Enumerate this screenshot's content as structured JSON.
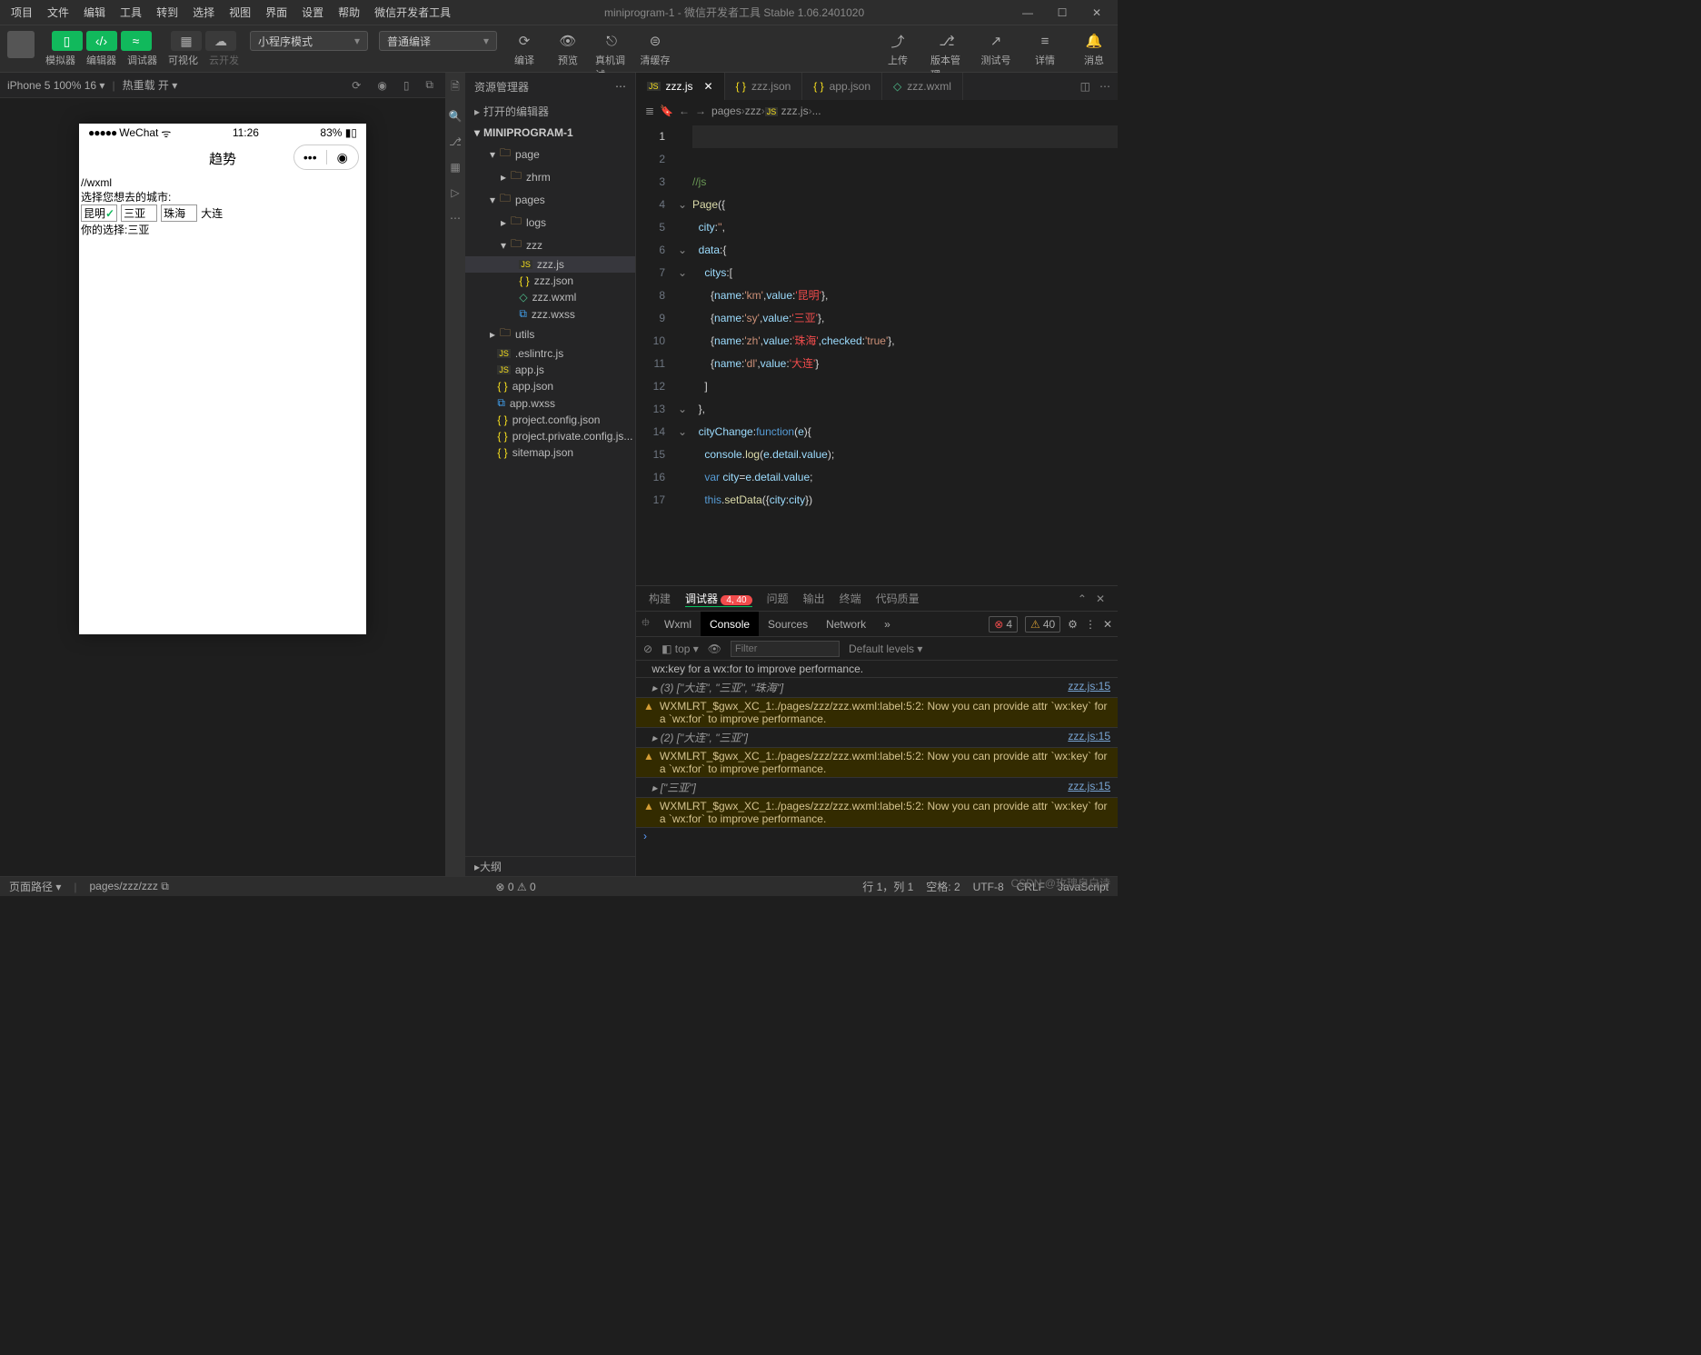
{
  "window": {
    "title": "miniprogram-1 - 微信开发者工具 Stable 1.06.2401020",
    "menus": [
      "项目",
      "文件",
      "编辑",
      "工具",
      "转到",
      "选择",
      "视图",
      "界面",
      "设置",
      "帮助",
      "微信开发者工具"
    ]
  },
  "toolbar": {
    "sim": "模拟器",
    "editor": "编辑器",
    "debugger": "调试器",
    "visual": "可视化",
    "cloud": "云开发",
    "mode": "小程序模式",
    "compile_mode": "普通编译",
    "compile": "编译",
    "preview": "预览",
    "remote": "真机调试",
    "clear": "清缓存",
    "upload": "上传",
    "version": "版本管理",
    "test": "测试号",
    "detail": "详情",
    "msg": "消息"
  },
  "simbar": {
    "device": "iPhone 5 100% 16",
    "hotreload": "热重载 开"
  },
  "phone": {
    "carrier": "WeChat",
    "time": "11:26",
    "battery": "83%",
    "title": "趋势",
    "body": {
      "l1": "//wxml",
      "l2": "选择您想去的城市:",
      "cities": [
        "昆明",
        "三亚",
        "珠海",
        "大连"
      ],
      "checked_index": 0,
      "selected": "你的选择:三亚"
    }
  },
  "explorer": {
    "title": "资源管理器",
    "s1": "打开的编辑器",
    "s2": "MINIPROGRAM-1",
    "outline": "大纲",
    "items": [
      {
        "ind": 1,
        "kind": "folder",
        "name": "page",
        "exp": true
      },
      {
        "ind": 2,
        "kind": "folder",
        "name": "zhrm",
        "exp": false
      },
      {
        "ind": 1,
        "kind": "folder",
        "name": "pages",
        "exp": true
      },
      {
        "ind": 2,
        "kind": "folder",
        "name": "logs",
        "exp": false
      },
      {
        "ind": 2,
        "kind": "folder",
        "name": "zzz",
        "exp": true
      },
      {
        "ind": 3,
        "kind": "js",
        "name": "zzz.js",
        "sel": true
      },
      {
        "ind": 3,
        "kind": "json",
        "name": "zzz.json"
      },
      {
        "ind": 3,
        "kind": "wxml",
        "name": "zzz.wxml"
      },
      {
        "ind": 3,
        "kind": "wxss",
        "name": "zzz.wxss"
      },
      {
        "ind": 1,
        "kind": "folder",
        "name": "utils",
        "exp": false
      },
      {
        "ind": 1,
        "kind": "js",
        "name": ".eslintrc.js"
      },
      {
        "ind": 1,
        "kind": "js",
        "name": "app.js"
      },
      {
        "ind": 1,
        "kind": "json",
        "name": "app.json"
      },
      {
        "ind": 1,
        "kind": "wxss",
        "name": "app.wxss"
      },
      {
        "ind": 1,
        "kind": "json",
        "name": "project.config.json"
      },
      {
        "ind": 1,
        "kind": "json",
        "name": "project.private.config.js..."
      },
      {
        "ind": 1,
        "kind": "json",
        "name": "sitemap.json"
      }
    ]
  },
  "tabs": [
    {
      "icon": "js",
      "name": "zzz.js",
      "active": true,
      "close": true
    },
    {
      "icon": "json",
      "name": "zzz.json"
    },
    {
      "icon": "json",
      "name": "app.json"
    },
    {
      "icon": "wxml",
      "name": "zzz.wxml"
    }
  ],
  "breadcrumb": [
    "pages",
    "zzz",
    "zzz.js",
    "..."
  ],
  "code": {
    "lines": [
      {
        "n": 1,
        "html": "",
        "cur": true
      },
      {
        "n": 2,
        "html": ""
      },
      {
        "n": 3,
        "html": "<span class='t-comment'>//js</span>"
      },
      {
        "n": 4,
        "html": "<span class='t-fn'>Page</span>({",
        "fold": true
      },
      {
        "n": 5,
        "html": "  <span class='t-prop'>city</span>:<span class='t-str'>''</span>,"
      },
      {
        "n": 6,
        "html": "  <span class='t-prop'>data</span>:{",
        "fold": true
      },
      {
        "n": 7,
        "html": "    <span class='t-prop'>citys</span>:[",
        "fold": true
      },
      {
        "n": 8,
        "html": "      {<span class='t-prop'>name</span>:<span class='t-str'>'km'</span>,<span class='t-prop'>value</span>:<span class='t-str2'>'昆明'</span>},"
      },
      {
        "n": 9,
        "html": "      {<span class='t-prop'>name</span>:<span class='t-str'>'sy'</span>,<span class='t-prop'>value</span>:<span class='t-str2'>'三亚'</span>},"
      },
      {
        "n": 10,
        "html": "      {<span class='t-prop'>name</span>:<span class='t-str'>'zh'</span>,<span class='t-prop'>value</span>:<span class='t-str2'>'珠海'</span>,<span class='t-prop'>checked</span>:<span class='t-str'>'true'</span>},"
      },
      {
        "n": 11,
        "html": "      {<span class='t-prop'>name</span>:<span class='t-str'>'dl'</span>,<span class='t-prop'>value</span>:<span class='t-str2'>'大连'</span>}"
      },
      {
        "n": 12,
        "html": "    ]"
      },
      {
        "n": 13,
        "html": "  },",
        "fold": true
      },
      {
        "n": 14,
        "html": "  <span class='t-prop'>cityChange</span>:<span class='t-var'>function</span>(<span class='t-prop'>e</span>){",
        "fold": true
      },
      {
        "n": 15,
        "html": "    <span class='t-prop'>console</span>.<span class='t-fn'>log</span>(<span class='t-prop'>e</span>.<span class='t-prop'>detail</span>.<span class='t-prop'>value</span>);"
      },
      {
        "n": 16,
        "html": "    <span class='t-var'>var</span> <span class='t-prop'>city</span>=<span class='t-prop'>e</span>.<span class='t-prop'>detail</span>.<span class='t-prop'>value</span>;"
      },
      {
        "n": 17,
        "html": "    <span class='t-var'>this</span>.<span class='t-fn'>setData</span>({<span class='t-prop'>city</span>:<span class='t-prop'>city</span>})"
      }
    ]
  },
  "panel": {
    "tabs": [
      "构建",
      "调试器",
      "问题",
      "输出",
      "终端",
      "代码质量"
    ],
    "active": 1,
    "badge": "4, 40",
    "dt": [
      "Wxml",
      "Console",
      "Sources",
      "Network"
    ],
    "dt_active": 1,
    "err_count": "4",
    "warn_count": "40",
    "filter_ph": "Filter",
    "levels": "Default levels",
    "top_ctx": "top",
    "logs": [
      {
        "type": "dim",
        "text": "wx:key  for a  wx:for  to improve performance."
      },
      {
        "type": "log",
        "text": "▸ (3) [\"大连\", \"三亚\", \"珠海\"]",
        "src": "zzz.js:15"
      },
      {
        "type": "warn",
        "text": "WXMLRT_$gwx_XC_1:./pages/zzz/zzz.wxml:label:5:2: Now you can provide attr `wx:key` for a `wx:for` to improve performance."
      },
      {
        "type": "log",
        "text": "▸ (2) [\"大连\", \"三亚\"]",
        "src": "zzz.js:15"
      },
      {
        "type": "warn",
        "text": "WXMLRT_$gwx_XC_1:./pages/zzz/zzz.wxml:label:5:2: Now you can provide attr `wx:key` for a `wx:for` to improve performance."
      },
      {
        "type": "log",
        "text": "▸ [\"三亚\"]",
        "src": "zzz.js:15"
      },
      {
        "type": "warn",
        "text": "WXMLRT_$gwx_XC_1:./pages/zzz/zzz.wxml:label:5:2: Now you can provide attr `wx:key` for a `wx:for` to improve performance."
      }
    ]
  },
  "status": {
    "path_label": "页面路径",
    "path": "pages/zzz/zzz",
    "err": "0",
    "warn": "0",
    "pos": "行 1，列 1",
    "spaces": "空格: 2",
    "enc": "UTF-8",
    "eol": "CRLF",
    "lang": "JavaScript"
  },
  "watermark": "CSDN @玫瑰自白诗"
}
